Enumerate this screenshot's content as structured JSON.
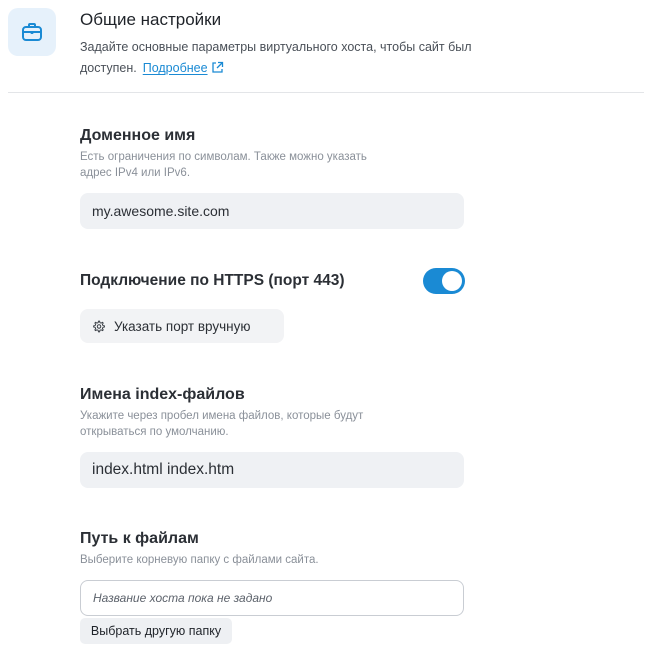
{
  "header": {
    "title": "Общие настройки",
    "description": "Задайте основные параметры виртуального хоста, чтобы сайт был доступен.",
    "more_link": "Подробнее",
    "icon": "briefcase-icon",
    "accent_color": "#1a8ad4"
  },
  "domain": {
    "title": "Доменное имя",
    "hint": "Есть ограничения по символам. Также можно указать адрес IPv4 или IPv6.",
    "value": "my.awesome.site.com"
  },
  "https": {
    "title": "Подключение по HTTPS (порт 443)",
    "enabled": true,
    "port_button": "Указать порт вручную"
  },
  "index_files": {
    "title": "Имена index-файлов",
    "hint": "Укажите через пробел имена файлов, которые будут открываться по умолчанию.",
    "value": "index.html index.htm"
  },
  "file_path": {
    "title": "Путь к файлам",
    "hint": "Выберите корневую папку с файлами сайта.",
    "placeholder": "Название хоста пока не задано",
    "choose_button": "Выбрать другую папку"
  }
}
